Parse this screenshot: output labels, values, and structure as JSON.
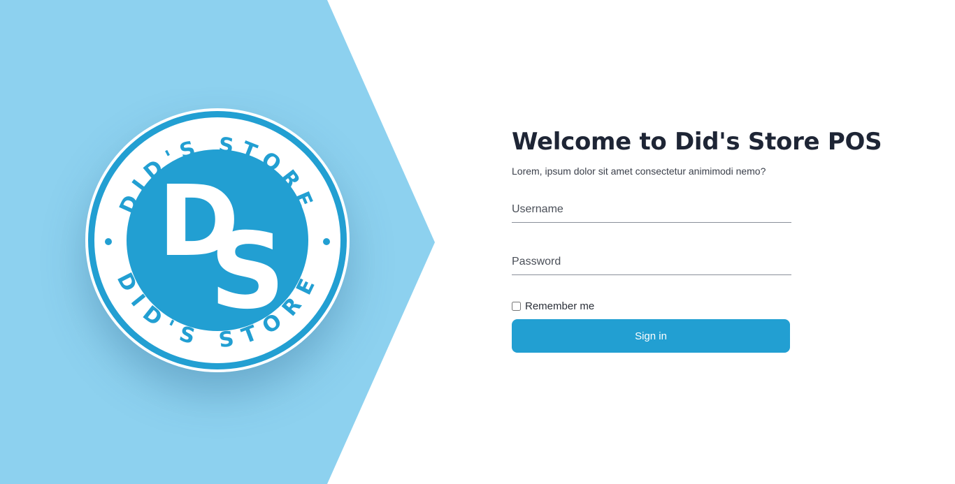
{
  "colors": {
    "hero_background": "#8dd1ef",
    "brand_blue": "#229fd2",
    "title": "#1e2535",
    "button_text": "#ffffff"
  },
  "logo": {
    "monogram_top": "D",
    "monogram_bottom": "S",
    "ring_text_top": "DID'S STORE",
    "ring_text_bottom": "DID'S STORE"
  },
  "login": {
    "title": "Welcome to Did's Store POS",
    "subtitle": "Lorem, ipsum dolor sit amet consectetur animimodi nemo?",
    "username_placeholder": "Username",
    "password_placeholder": "Password",
    "remember_label": "Remember me",
    "remember_checked": false,
    "signin_label": "Sign in"
  }
}
